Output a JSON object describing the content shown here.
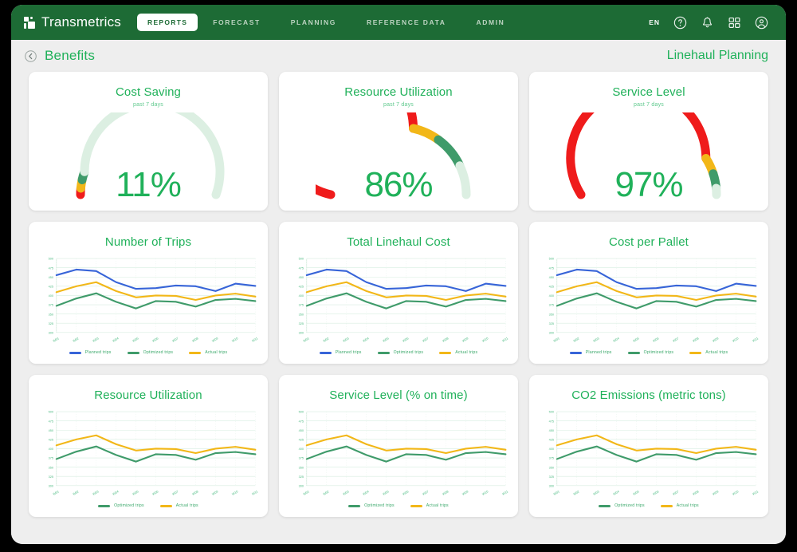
{
  "navbar": {
    "brand": "Transmetrics",
    "brand_logo_icon": "transmetrics-logo-icon",
    "links": [
      {
        "label": "REPORTS",
        "active": true
      },
      {
        "label": "FORECAST",
        "active": false
      },
      {
        "label": "PLANNING",
        "active": false
      },
      {
        "label": "REFERENCE DATA",
        "active": false
      },
      {
        "label": "ADMIN",
        "active": false
      }
    ],
    "language": "EN",
    "icons": [
      "help-icon",
      "notifications-bell-icon",
      "apps-grid-icon",
      "user-account-icon"
    ],
    "background_color": "#1d6b35"
  },
  "header": {
    "back_icon": "back-chevron-circle-icon",
    "title": "Benefits",
    "context": "Linehaul Planning",
    "accent_color": "#20b15a"
  },
  "gauges": [
    {
      "title": "Cost Saving",
      "subtitle": "past 7 days",
      "value": "11%",
      "percent": 11,
      "segments": [
        {
          "color": "#ef1b1b",
          "from": 0,
          "to": 3
        },
        {
          "color": "#f2b718",
          "from": 3,
          "to": 7
        },
        {
          "color": "#3f9b6a",
          "from": 7,
          "to": 11
        },
        {
          "color": "#dcefe2",
          "from": 11,
          "to": 100
        }
      ]
    },
    {
      "title": "Resource Utilization",
      "subtitle": "past 7 days",
      "value": "86%",
      "percent": 86,
      "segments": [
        {
          "color": "#ef1b1b",
          "from": 0,
          "to": 57
        },
        {
          "color": "#f2b718",
          "from": 57,
          "to": 70
        },
        {
          "color": "#3f9b6a",
          "from": 70,
          "to": 86
        },
        {
          "color": "#dcefe2",
          "from": 86,
          "to": 100
        }
      ]
    },
    {
      "title": "Service Level",
      "subtitle": "past 7 days",
      "value": "97%",
      "percent": 97,
      "segments": [
        {
          "color": "#ef1b1b",
          "from": 0,
          "to": 82
        },
        {
          "color": "#f2b718",
          "from": 82,
          "to": 90
        },
        {
          "color": "#3f9b6a",
          "from": 90,
          "to": 97
        },
        {
          "color": "#dcefe2",
          "from": 97,
          "to": 100
        }
      ]
    }
  ],
  "chart_data": [
    {
      "type": "line",
      "title": "Number of Trips",
      "xlabel": "",
      "ylabel": "",
      "ylim": [
        300,
        500
      ],
      "yticks": [
        300,
        325,
        350,
        375,
        400,
        425,
        450,
        475,
        500
      ],
      "grid": true,
      "legend_position": "bottom",
      "categories": [
        "W01",
        "W02",
        "W03",
        "W04",
        "W05",
        "W06",
        "W07",
        "W08",
        "W09",
        "W10",
        "W11"
      ],
      "series": [
        {
          "name": "Planned trips",
          "color": "#3764d8",
          "values": [
            455,
            470,
            466,
            436,
            418,
            420,
            427,
            425,
            412,
            432,
            426
          ]
        },
        {
          "name": "Optimized trips",
          "color": "#3f9b6a",
          "values": [
            372,
            392,
            406,
            383,
            365,
            385,
            383,
            370,
            388,
            391,
            385
          ]
        },
        {
          "name": "Actual trips",
          "color": "#f2b718",
          "values": [
            409,
            425,
            436,
            412,
            395,
            400,
            399,
            388,
            400,
            405,
            397
          ]
        }
      ]
    },
    {
      "type": "line",
      "title": "Total Linehaul Cost",
      "xlabel": "",
      "ylabel": "",
      "ylim": [
        300,
        500
      ],
      "yticks": [
        300,
        325,
        350,
        375,
        400,
        425,
        450,
        475,
        500
      ],
      "grid": true,
      "legend_position": "bottom",
      "categories": [
        "W01",
        "W02",
        "W03",
        "W04",
        "W05",
        "W06",
        "W07",
        "W08",
        "W09",
        "W10",
        "W11"
      ],
      "series": [
        {
          "name": "Planned trips",
          "color": "#3764d8",
          "values": [
            455,
            470,
            466,
            436,
            418,
            420,
            427,
            425,
            412,
            432,
            426
          ]
        },
        {
          "name": "Optimized trips",
          "color": "#3f9b6a",
          "values": [
            372,
            392,
            406,
            383,
            365,
            385,
            383,
            370,
            388,
            391,
            385
          ]
        },
        {
          "name": "Actual trips",
          "color": "#f2b718",
          "values": [
            409,
            425,
            436,
            412,
            395,
            400,
            399,
            388,
            400,
            405,
            397
          ]
        }
      ]
    },
    {
      "type": "line",
      "title": "Cost per Pallet",
      "xlabel": "",
      "ylabel": "",
      "ylim": [
        300,
        500
      ],
      "yticks": [
        300,
        325,
        350,
        375,
        400,
        425,
        450,
        475,
        500
      ],
      "grid": true,
      "legend_position": "bottom",
      "categories": [
        "W01",
        "W02",
        "W03",
        "W04",
        "W05",
        "W06",
        "W07",
        "W08",
        "W09",
        "W10",
        "W11"
      ],
      "series": [
        {
          "name": "Planned trips",
          "color": "#3764d8",
          "values": [
            455,
            470,
            466,
            436,
            418,
            420,
            427,
            425,
            412,
            432,
            426
          ]
        },
        {
          "name": "Optimized trips",
          "color": "#3f9b6a",
          "values": [
            372,
            392,
            406,
            383,
            365,
            385,
            383,
            370,
            388,
            391,
            385
          ]
        },
        {
          "name": "Actual trips",
          "color": "#f2b718",
          "values": [
            409,
            425,
            436,
            412,
            395,
            400,
            399,
            388,
            400,
            405,
            397
          ]
        }
      ]
    },
    {
      "type": "line",
      "title": "Resource Utilization",
      "xlabel": "",
      "ylabel": "",
      "ylim": [
        300,
        500
      ],
      "yticks": [
        300,
        325,
        350,
        375,
        400,
        425,
        450,
        475,
        500
      ],
      "grid": true,
      "legend_position": "bottom",
      "categories": [
        "W01",
        "W02",
        "W03",
        "W04",
        "W05",
        "W06",
        "W07",
        "W08",
        "W09",
        "W10",
        "W11"
      ],
      "series": [
        {
          "name": "Optimized trips",
          "color": "#3f9b6a",
          "values": [
            372,
            392,
            406,
            383,
            365,
            385,
            383,
            370,
            388,
            391,
            385
          ]
        },
        {
          "name": "Actual trips",
          "color": "#f2b718",
          "values": [
            409,
            425,
            436,
            412,
            395,
            400,
            399,
            388,
            400,
            405,
            397
          ]
        }
      ]
    },
    {
      "type": "line",
      "title": "Service Level (% on time)",
      "xlabel": "",
      "ylabel": "",
      "ylim": [
        300,
        500
      ],
      "yticks": [
        300,
        325,
        350,
        375,
        400,
        425,
        450,
        475,
        500
      ],
      "grid": true,
      "legend_position": "bottom",
      "categories": [
        "W01",
        "W02",
        "W03",
        "W04",
        "W05",
        "W06",
        "W07",
        "W08",
        "W09",
        "W10",
        "W11"
      ],
      "series": [
        {
          "name": "Optimized trips",
          "color": "#3f9b6a",
          "values": [
            372,
            392,
            406,
            383,
            365,
            385,
            383,
            370,
            388,
            391,
            385
          ]
        },
        {
          "name": "Actual trips",
          "color": "#f2b718",
          "values": [
            409,
            425,
            436,
            412,
            395,
            400,
            399,
            388,
            400,
            405,
            397
          ]
        }
      ]
    },
    {
      "type": "line",
      "title": "CO2 Emissions (metric tons)",
      "xlabel": "",
      "ylabel": "",
      "ylim": [
        300,
        500
      ],
      "yticks": [
        300,
        325,
        350,
        375,
        400,
        425,
        450,
        475,
        500
      ],
      "grid": true,
      "legend_position": "bottom",
      "categories": [
        "W01",
        "W02",
        "W03",
        "W04",
        "W05",
        "W06",
        "W07",
        "W08",
        "W09",
        "W10",
        "W11"
      ],
      "series": [
        {
          "name": "Optimized trips",
          "color": "#3f9b6a",
          "values": [
            372,
            392,
            406,
            383,
            365,
            385,
            383,
            370,
            388,
            391,
            385
          ]
        },
        {
          "name": "Actual trips",
          "color": "#f2b718",
          "values": [
            409,
            425,
            436,
            412,
            395,
            400,
            399,
            388,
            400,
            405,
            397
          ]
        }
      ]
    }
  ]
}
